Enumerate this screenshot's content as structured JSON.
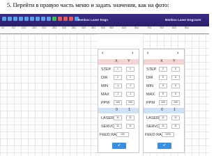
{
  "instruction": "5.  Перейти в правую часть меню и задать значения, как на фото:",
  "app": {
    "title": "Benbox Laser Engraver"
  },
  "ruler": [
    "0.0",
    "5.0",
    "10.0",
    "15.0",
    "20.0",
    "25.0",
    "30.0",
    "35.0",
    "40.0",
    "45.0",
    "50.0",
    "55.0",
    "60.0",
    "65.0",
    "70.0",
    "75.0",
    "80.0",
    "85.0"
  ],
  "panel": {
    "nav_prev": "‹",
    "nav_next": "›",
    "header_x": "X",
    "header_y": "Y",
    "subheader_0": "0",
    "subheader_1": "1",
    "ok_icon": "✔"
  },
  "left_rows": [
    {
      "label": "STEP",
      "x": "1",
      "y": "1"
    },
    {
      "label": "DIR",
      "x": "1",
      "y": "1"
    },
    {
      "label": "MIN",
      "x": "-1",
      "y": "-1"
    },
    {
      "label": "MAX",
      "x": "-1",
      "y": "-1"
    },
    {
      "label": "PPM",
      "x": "100",
      "y": "100"
    }
  ],
  "left_extra": [
    {
      "label": "LASER",
      "x": "11",
      "y": "11"
    },
    {
      "label": "SERVO",
      "x": "11",
      "y": "11"
    },
    {
      "label": "FEED RA...",
      "x": "100",
      "y": ""
    }
  ],
  "right_rows": [
    {
      "label": "STEP",
      "x": "2",
      "y": "3"
    },
    {
      "label": "DIR",
      "x": "5",
      "y": "6"
    },
    {
      "label": "MIN",
      "x": "9",
      "y": "9"
    },
    {
      "label": "MAX",
      "x": "9",
      "y": "9"
    },
    {
      "label": "PPM",
      "x": "100",
      "y": "100"
    }
  ],
  "right_extra": [
    {
      "label": "LASER",
      "x": "11",
      "y": "11"
    },
    {
      "label": "SERVO",
      "x": "11",
      "y": "11"
    },
    {
      "label": "FEED RA...",
      "x": "1000",
      "y": ""
    }
  ]
}
